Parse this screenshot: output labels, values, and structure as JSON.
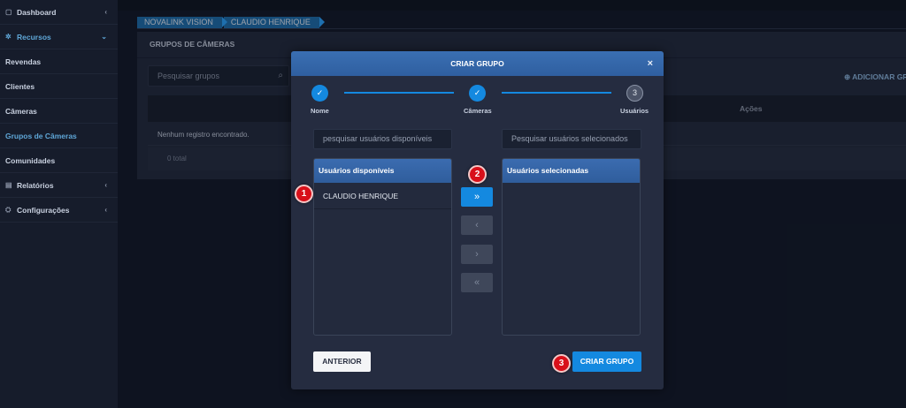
{
  "sidebar": {
    "items": [
      {
        "label": "Dashboard",
        "icon": "dashboard-icon"
      },
      {
        "label": "Recursos",
        "icon": "gear-icon"
      },
      {
        "label": "Revendas"
      },
      {
        "label": "Clientes"
      },
      {
        "label": "Câmeras"
      },
      {
        "label": "Grupos de Câmeras"
      },
      {
        "label": "Comunidades"
      },
      {
        "label": "Relatórios",
        "icon": "document-icon"
      },
      {
        "label": "Configurações",
        "icon": "settings-icon"
      }
    ]
  },
  "breadcrumb": [
    "NOVALINK VISION",
    "CLAUDIO HENRIQUE"
  ],
  "page": {
    "title": "GRUPOS DE CÂMERAS",
    "search_placeholder": "Pesquisar grupos",
    "add_label": "ADICIONAR GRUPO",
    "col_actions": "Ações",
    "empty": "Nenhum registro encontrado.",
    "total": "0 total"
  },
  "modal": {
    "title": "CRIAR GRUPO",
    "close": "×",
    "steps": [
      {
        "label": "Nome",
        "marker": "✓"
      },
      {
        "label": "Câmeras",
        "marker": "✓"
      },
      {
        "label": "Usuários",
        "marker": "3"
      }
    ],
    "search_available_placeholder": "pesquisar usuários disponíveis",
    "search_selected_placeholder": "Pesquisar usuários selecionados",
    "available_header": "Usuários disponíveis",
    "selected_header": "Usuários selecionadas",
    "available_users": [
      "CLAUDIO HENRIQUE"
    ],
    "selected_users": [],
    "buttons": {
      "move_all_right": "»",
      "move_left": "‹",
      "move_right": "›",
      "move_all_left": "«",
      "previous": "ANTERIOR",
      "create": "CRIAR GRUPO"
    }
  },
  "annotations": [
    "1",
    "2",
    "3"
  ],
  "colors": {
    "accent": "#1489e0",
    "header_blue": "#3a6fb3",
    "badge_red": "#d8101a",
    "background": "#111827"
  }
}
